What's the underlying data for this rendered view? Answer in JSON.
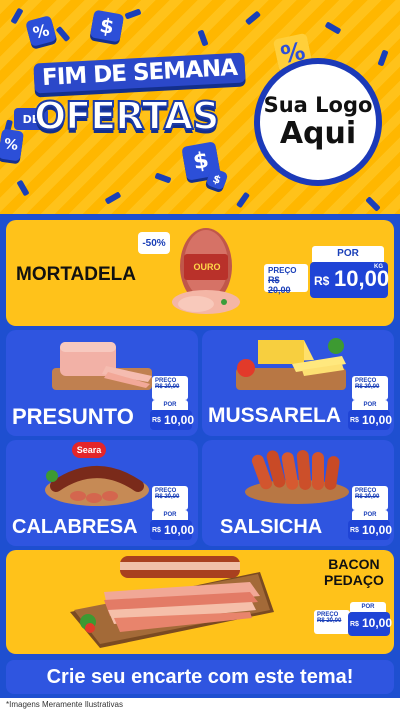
{
  "header": {
    "title_line1": "FIM DE SEMANA",
    "title_de": "DE",
    "title_line2": "OFERTAS",
    "logo_line1": "Sua Logo",
    "logo_line2": "Aqui",
    "cube_percent": "%",
    "cube_dollar": "$"
  },
  "products": [
    {
      "name": "MORTADELA",
      "badge": "-50%",
      "brand": "OURO",
      "preco_label": "PREÇO",
      "old_price": "R$ 20,00",
      "por_label": "POR",
      "currency": "R$",
      "price": "10,00",
      "unit": "KG"
    },
    {
      "name": "PRESUNTO",
      "preco_label": "PREÇO",
      "old_price": "R$ 20,00",
      "por_label": "POR",
      "currency": "R$",
      "price": "10,00",
      "unit": "KG"
    },
    {
      "name": "MUSSARELA",
      "preco_label": "PREÇO",
      "old_price": "R$ 20,00",
      "por_label": "POR",
      "currency": "R$",
      "price": "10,00",
      "unit": "KG"
    },
    {
      "name": "CALABRESA",
      "brand": "Seara",
      "preco_label": "PREÇO",
      "old_price": "R$ 20,00",
      "por_label": "POR",
      "currency": "R$",
      "price": "10,00",
      "unit": "KG"
    },
    {
      "name": "SALSICHA",
      "preco_label": "PREÇO",
      "old_price": "R$ 20,00",
      "por_label": "POR",
      "currency": "R$",
      "price": "10,00",
      "unit": "KG"
    },
    {
      "name_line1": "BACON",
      "name_line2": "PEDAÇO",
      "preco_label": "PREÇO",
      "old_price": "R$ 20,00",
      "por_label": "POR",
      "currency": "R$",
      "price": "10,00",
      "unit": "KG"
    }
  ],
  "footer": {
    "cta": "Crie seu encarte com este tema!",
    "disclaimer": "*Imagens Meramente Ilustrativas"
  },
  "colors": {
    "yellow": "#ffc21a",
    "blue": "#2f55e0",
    "dark_blue": "#1a3fb8"
  }
}
